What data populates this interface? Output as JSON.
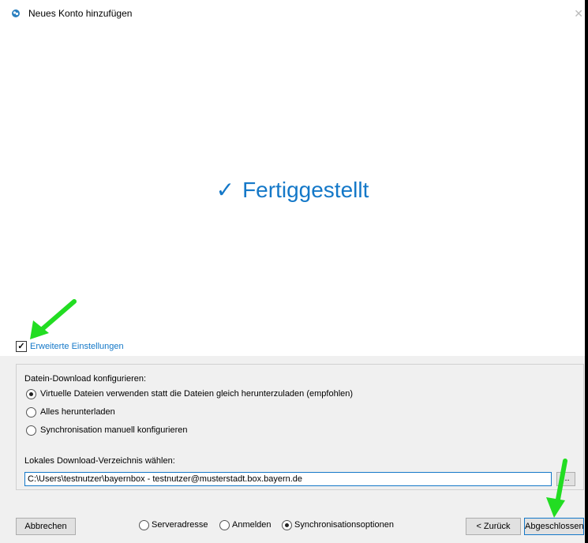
{
  "window": {
    "title": "Neues Konto hinzufügen",
    "close_glyph": "✕"
  },
  "status": {
    "check": "✓",
    "text": "Fertiggestellt"
  },
  "advanced": {
    "checked": true,
    "check_glyph": "✓",
    "label": "Erweiterte Einstellungen"
  },
  "download": {
    "section_label": "Datein-Download konfigurieren:",
    "options": [
      {
        "label": "Virtuelle Dateien verwenden statt die Dateien gleich herunterzuladen (empfohlen)",
        "selected": true
      },
      {
        "label": "Alles herunterladen",
        "selected": false
      },
      {
        "label": "Synchronisation manuell konfigurieren",
        "selected": false
      }
    ],
    "dir_label": "Lokales Download-Verzeichnis wählen:",
    "dir_value": "C:\\Users\\testnutzer\\bayernbox - testnutzer@musterstadt.box.bayern.de",
    "browse_label": "..."
  },
  "footer": {
    "cancel_label": "Abbrechen",
    "steps": [
      {
        "label": "Serveradresse",
        "selected": false
      },
      {
        "label": "Anmelden",
        "selected": false
      },
      {
        "label": "Synchronisationsoptionen",
        "selected": true
      }
    ],
    "back_label": "< Zurück",
    "finish_label": "Abgeschlossen"
  },
  "colors": {
    "accent": "#1478c8",
    "arrow": "#22dd22"
  }
}
